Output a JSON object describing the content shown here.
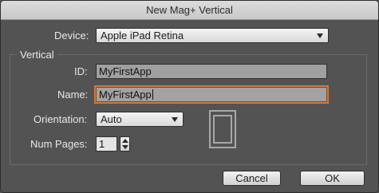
{
  "window": {
    "title": "New Mag+ Vertical"
  },
  "device": {
    "label": "Device:",
    "value": "Apple iPad Retina"
  },
  "group": {
    "title": "Vertical"
  },
  "id_field": {
    "label": "ID:",
    "value": "MyFirstApp"
  },
  "name_field": {
    "label": "Name:",
    "value": "MyFirstApp"
  },
  "orientation": {
    "label": "Orientation:",
    "value": "Auto"
  },
  "num_pages": {
    "label": "Num Pages:",
    "value": "1"
  },
  "buttons": {
    "cancel": "Cancel",
    "ok": "OK"
  },
  "icons": {
    "device_preview": "tablet-portrait-icon",
    "stepper": "stepper-icon",
    "dropdown": "chevron-down-icon"
  },
  "colors": {
    "background": "#535353",
    "focus": "#d6793a",
    "field": "#a0a0a0"
  }
}
